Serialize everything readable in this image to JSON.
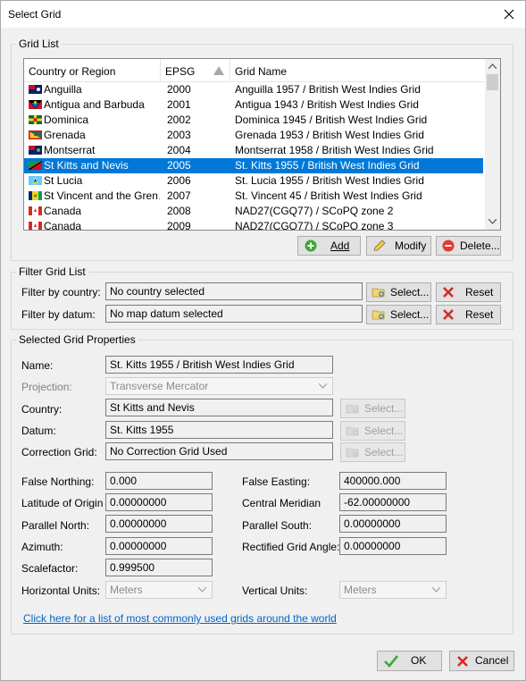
{
  "window": {
    "title": "Select Grid"
  },
  "grid_list": {
    "label": "Grid List",
    "columns": [
      "Country or Region",
      "EPSG",
      "Grid Name"
    ],
    "rows": [
      {
        "country": "Anguilla",
        "epsg": "2000",
        "name": "Anguilla 1957 / British West Indies Grid"
      },
      {
        "country": "Antigua and Barbuda",
        "epsg": "2001",
        "name": "Antigua 1943 / British West Indies Grid"
      },
      {
        "country": "Dominica",
        "epsg": "2002",
        "name": "Dominica 1945 / British West Indies Grid"
      },
      {
        "country": "Grenada",
        "epsg": "2003",
        "name": "Grenada 1953 / British West Indies Grid"
      },
      {
        "country": "Montserrat",
        "epsg": "2004",
        "name": "Montserrat 1958 / British West Indies Grid"
      },
      {
        "country": "St Kitts and Nevis",
        "epsg": "2005",
        "name": "St. Kitts 1955 / British West Indies Grid"
      },
      {
        "country": "St Lucia",
        "epsg": "2006",
        "name": "St. Lucia 1955 / British West Indies Grid"
      },
      {
        "country": "St Vincent and the Gren…",
        "epsg": "2007",
        "name": "St. Vincent 45 / British West Indies Grid"
      },
      {
        "country": "Canada",
        "epsg": "2008",
        "name": "NAD27(CGQ77) / SCoPQ zone 2"
      },
      {
        "country": "Canada",
        "epsg": "2009",
        "name": "NAD27(CGQ77) / SCoPQ zone 3"
      }
    ],
    "selected_index": 5,
    "buttons": {
      "add": "Add",
      "modify": "Modify",
      "delete": "Delete..."
    }
  },
  "filter": {
    "label": "Filter Grid List",
    "country_label": "Filter by country:",
    "country_value": "No country selected",
    "datum_label": "Filter by datum:",
    "datum_value": "No map datum selected",
    "select": "Select...",
    "reset": "Reset"
  },
  "properties": {
    "label": "Selected Grid Properties",
    "name_label": "Name:",
    "name_value": "St. Kitts 1955 / British West Indies Grid",
    "projection_label": "Projection:",
    "projection_value": "Transverse Mercator",
    "country_label": "Country:",
    "country_value": "St Kitts and Nevis",
    "datum_label": "Datum:",
    "datum_value": "St. Kitts 1955",
    "correction_label": "Correction Grid:",
    "correction_value": "No Correction Grid Used",
    "select": "Select...",
    "false_northing_label": "False Northing:",
    "false_northing": "0.000",
    "false_easting_label": "False Easting:",
    "false_easting": "400000.000",
    "lat_origin_label": "Latitude of Origin",
    "lat_origin": "0.00000000",
    "central_meridian_label": "Central Meridian",
    "central_meridian": "-62.00000000",
    "parallel_north_label": "Parallel North:",
    "parallel_north": "0.00000000",
    "parallel_south_label": "Parallel South:",
    "parallel_south": "0.00000000",
    "azimuth_label": "Azimuth:",
    "azimuth": "0.00000000",
    "rectified_label": "Rectified Grid Angle:",
    "rectified": "0.00000000",
    "scalefactor_label": "Scalefactor:",
    "scalefactor": "0.999500",
    "horiz_units_label": "Horizontal Units:",
    "horiz_units": "Meters",
    "vert_units_label": "Vertical Units:",
    "vert_units": "Meters",
    "link": "Click here for a list of most commonly used grids around the world"
  },
  "footer": {
    "ok": "OK",
    "cancel": "Cancel"
  },
  "colors": {
    "selection": "#0078d7",
    "link": "#0066cc"
  }
}
